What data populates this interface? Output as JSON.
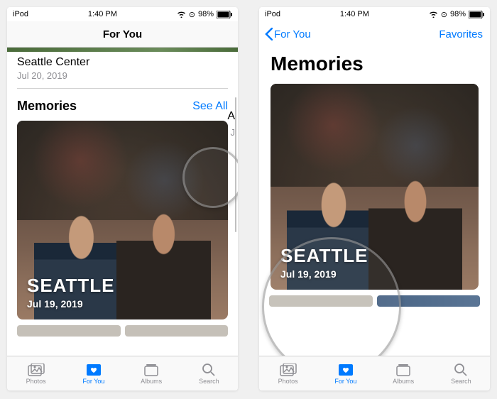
{
  "status": {
    "device": "iPod",
    "time": "1:40 PM",
    "battery": "98%"
  },
  "left": {
    "nav_title": "For You",
    "place_name": "Seattle Center",
    "place_date": "Jul 20, 2019",
    "section_title": "Memories",
    "see_all": "See All",
    "memory_title": "SEATTLE",
    "memory_date": "Jul 19, 2019",
    "cut_letter": "A",
    "cut_j": "J"
  },
  "right": {
    "back_label": "For You",
    "nav_right": "Favorites",
    "page_title": "Memories",
    "memory_title": "SEATTLE",
    "memory_date": "Jul 19, 2019"
  },
  "tabs": {
    "photos": "Photos",
    "for_you": "For You",
    "albums": "Albums",
    "search": "Search"
  }
}
